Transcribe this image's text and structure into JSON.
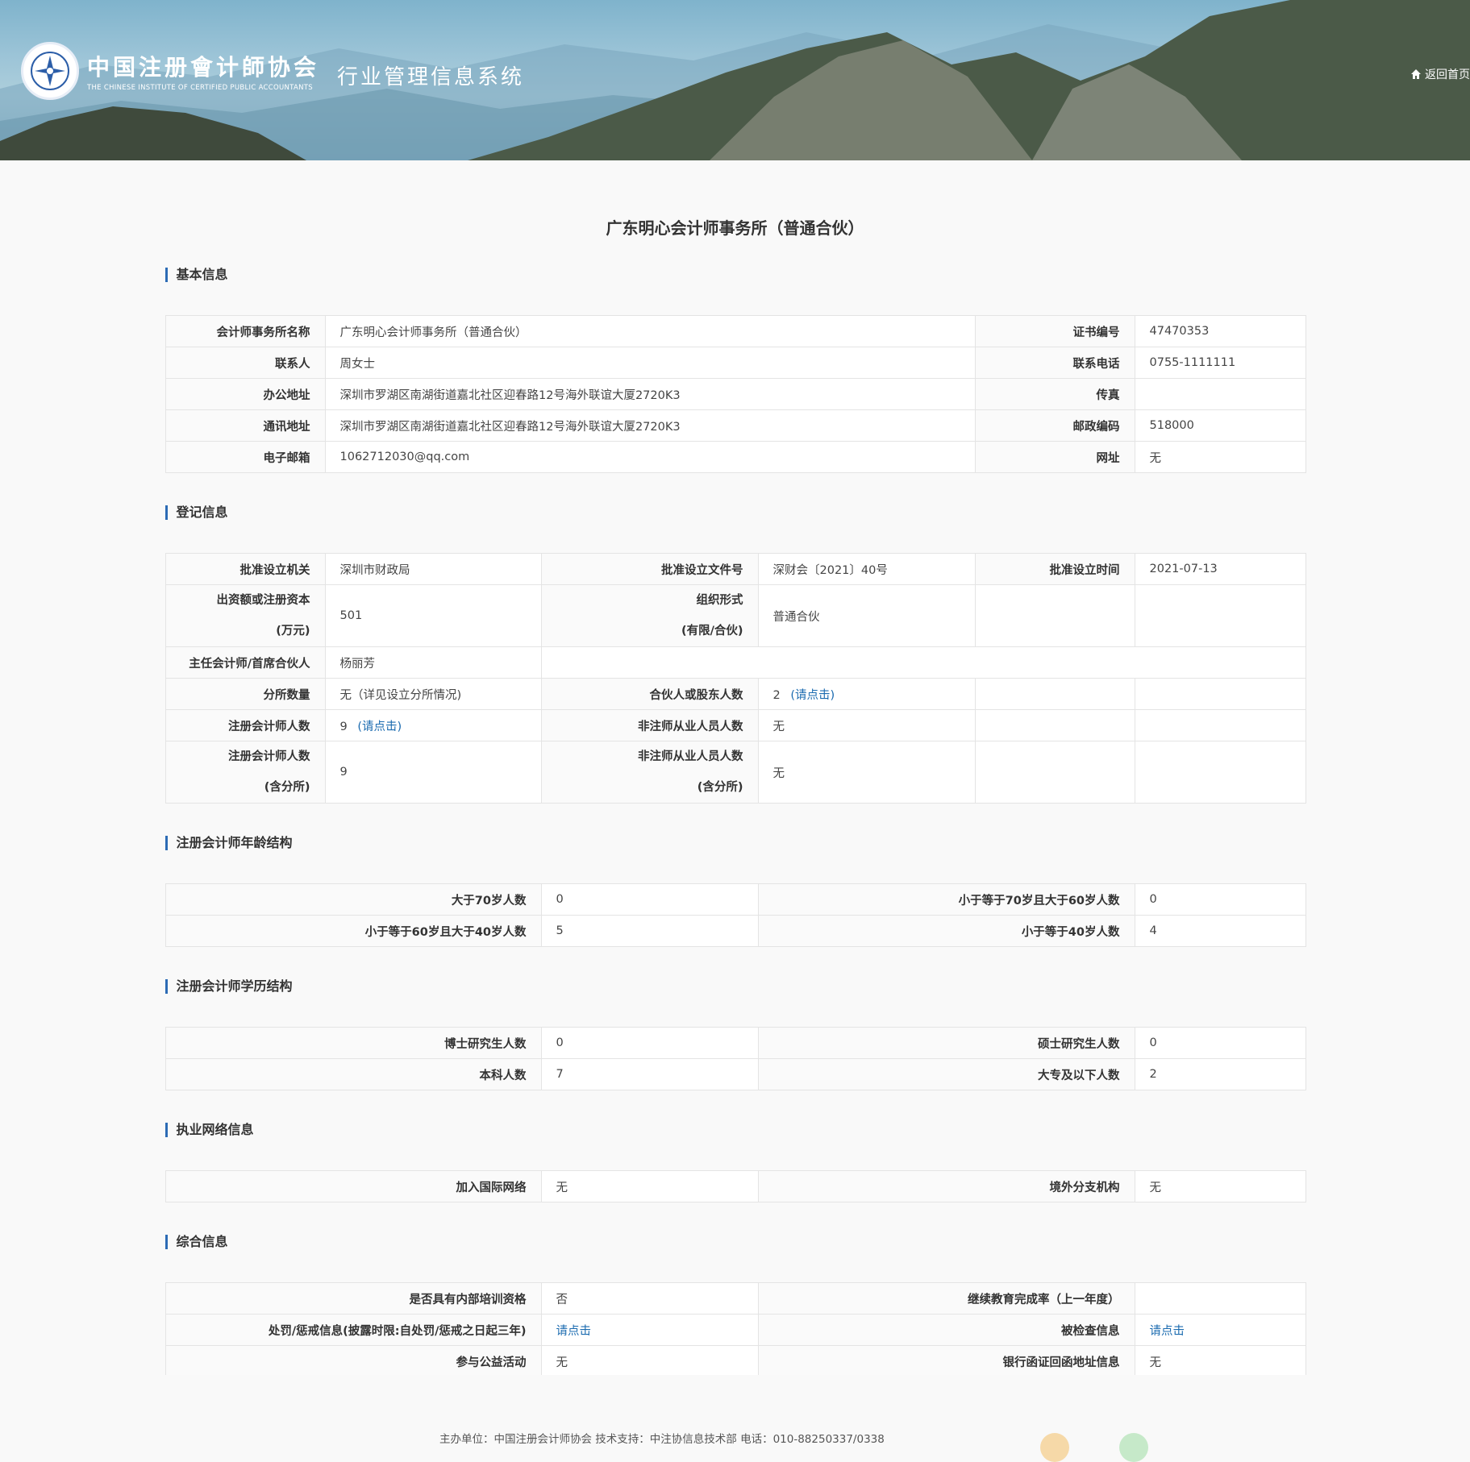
{
  "header": {
    "org_cn": "中国注册會计師协会",
    "org_en": "THE CHINESE INSTITUTE OF CERTIFIED PUBLIC ACCOUNTANTS",
    "system_name": "行业管理信息系统",
    "home_link": "返回首页"
  },
  "page_title": "广东明心会计师事务所（普通合伙）",
  "sections": {
    "basic": {
      "title": "基本信息",
      "firm_name_label": "会计师事务所名称",
      "firm_name": "广东明心会计师事务所（普通合伙）",
      "cert_no_label": "证书编号",
      "cert_no": "47470353",
      "contact_label": "联系人",
      "contact": "周女士",
      "phone_label": "联系电话",
      "phone": "0755-1111111",
      "office_addr_label": "办公地址",
      "office_addr": "深圳市罗湖区南湖街道嘉北社区迎春路12号海外联谊大厦2720K3",
      "fax_label": "传真",
      "fax": "",
      "mail_addr_label": "通讯地址",
      "mail_addr": "深圳市罗湖区南湖街道嘉北社区迎春路12号海外联谊大厦2720K3",
      "postcode_label": "邮政编码",
      "postcode": "518000",
      "email_label": "电子邮箱",
      "email": "1062712030@qq.com",
      "website_label": "网址",
      "website": "无"
    },
    "registration": {
      "title": "登记信息",
      "authority_label": "批准设立机关",
      "authority": "深圳市财政局",
      "doc_no_label": "批准设立文件号",
      "doc_no": "深财会〔2021〕40号",
      "date_label": "批准设立时间",
      "date": "2021-07-13",
      "capital_label_1": "出资额或注册资本",
      "capital_label_2": "(万元)",
      "capital": "501",
      "org_form_label_1": "组织形式",
      "org_form_label_2": "(有限/合伙)",
      "org_form": "普通合伙",
      "chief_label": "主任会计师/首席合伙人",
      "chief": "杨丽芳",
      "branches_label": "分所数量",
      "branches": "无（详见设立分所情况)",
      "partners_label": "合伙人或股东人数",
      "partners": "2",
      "partners_link": "(请点击)",
      "cpa_label": "注册会计师人数",
      "cpa": "9",
      "cpa_link": "(请点击)",
      "noncpa_label": "非注师从业人员人数",
      "noncpa": "无",
      "cpa_total_label_1": "注册会计师人数",
      "cpa_total_label_2": "(含分所)",
      "cpa_total": "9",
      "noncpa_total_label_1": "非注师从业人员人数",
      "noncpa_total_label_2": "(含分所)",
      "noncpa_total": "无"
    },
    "age": {
      "title": "注册会计师年龄结构",
      "over70_label": "大于70岁人数",
      "over70": "0",
      "60to70_label": "小于等于70岁且大于60岁人数",
      "60to70": "0",
      "40to60_label": "小于等于60岁且大于40岁人数",
      "40to60": "5",
      "under40_label": "小于等于40岁人数",
      "under40": "4"
    },
    "education": {
      "title": "注册会计师学历结构",
      "phd_label": "博士研究生人数",
      "phd": "0",
      "master_label": "硕士研究生人数",
      "master": "0",
      "bachelor_label": "本科人数",
      "bachelor": "7",
      "college_label": "大专及以下人数",
      "college": "2"
    },
    "network": {
      "title": "执业网络信息",
      "intl_label": "加入国际网络",
      "intl": "无",
      "overseas_label": "境外分支机构",
      "overseas": "无"
    },
    "general": {
      "title": "综合信息",
      "training_label": "是否具有内部培训资格",
      "training": "否",
      "edu_rate_label": "继续教育完成率（上一年度）",
      "edu_rate": "",
      "penalty_label": "处罚/惩戒信息(披露时限:自处罚/惩戒之日起三年)",
      "penalty_link": "请点击",
      "inspected_label": "被检查信息",
      "inspected_link": "请点击",
      "charity_label": "参与公益活动",
      "charity": "无",
      "bank_label": "银行函证回函地址信息",
      "bank": "无"
    }
  },
  "footer": {
    "text": "主办单位：中国注册会计师协会 技术支持：中注协信息技术部 电话：010-88250337/0338"
  },
  "icons": [
    "emblem-icon",
    "home-icon"
  ]
}
